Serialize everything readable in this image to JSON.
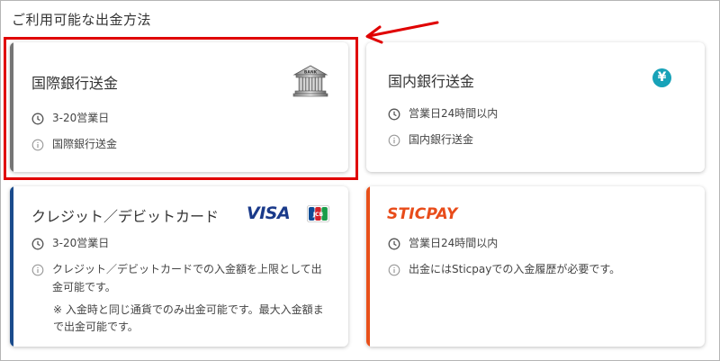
{
  "page": {
    "title": "ご利用可能な出金方法"
  },
  "cards": [
    {
      "title": "国際銀行送金",
      "time": "3-20営業日",
      "info": "国際銀行送金",
      "icon": "bank-building-icon",
      "icon_label": "BANK",
      "accent_color": "#757575",
      "selected": true
    },
    {
      "title": "国内銀行送金",
      "time": "営業日24時間以内",
      "info": "国内銀行送金",
      "icon": "yen-circle-icon",
      "icon_symbol": "¥",
      "accent_color": "#ffffff"
    },
    {
      "title": "クレジット／デビットカード",
      "time": "3-20営業日",
      "info": "クレジット／デビットカードでの入金額を上限として出金可能です。",
      "info_line1": "クレジット／デビットカードでの入金額を上限として出",
      "info_line2": "金可能です。",
      "note_line1": "※ 入金時と同じ通貨でのみ出金可能です。最大入金額ま",
      "note_line2": "で出金可能です。",
      "logos": {
        "visa": "VISA",
        "jcb": "JCB"
      },
      "accent_color": "#1a4b8c"
    },
    {
      "title": "STICPAY",
      "time": "営業日24時間以内",
      "info": "出金にはSticpayでの入金履歴が必要です。",
      "accent_color": "#e8501a"
    }
  ],
  "colors": {
    "highlight": "#e00000",
    "yen": "#17a2b8"
  }
}
